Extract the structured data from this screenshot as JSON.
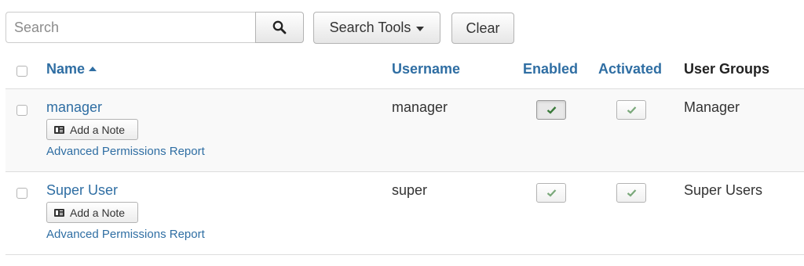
{
  "toolbar": {
    "search_placeholder": "Search",
    "search_tools_label": "Search Tools",
    "clear_label": "Clear"
  },
  "table": {
    "headers": {
      "name": "Name",
      "username": "Username",
      "enabled": "Enabled",
      "activated": "Activated",
      "user_groups": "User Groups"
    },
    "sort": {
      "column": "Name",
      "direction": "ascending"
    },
    "rows": [
      {
        "name": "manager",
        "note_label": "Add a Note",
        "permissions_label": "Advanced Permissions Report",
        "username": "manager",
        "enabled": true,
        "activated": true,
        "user_groups": "Manager"
      },
      {
        "name": "Super User",
        "note_label": "Add a Note",
        "permissions_label": "Advanced Permissions Report",
        "username": "super",
        "enabled": true,
        "activated": true,
        "user_groups": "Super Users"
      }
    ]
  },
  "icons": {
    "search": "search-icon",
    "search_tools_caret": "caret-down-icon",
    "sort": "caret-up-icon",
    "note": "id-card-icon",
    "check": "checkmark-icon"
  },
  "colors": {
    "link": "#2f6ea3",
    "check_enabled_active": "#3a7a3a",
    "check_muted": "#7aa87a",
    "row_alt_bg": "#f9f9f9"
  }
}
